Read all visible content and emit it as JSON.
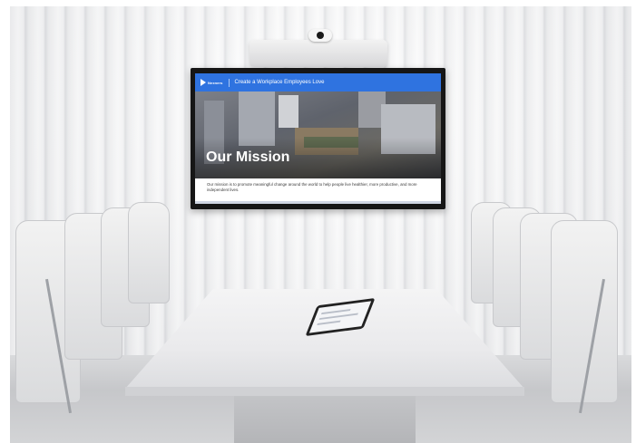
{
  "screen": {
    "logo_text": "Nexners",
    "header_title": "Create a Workplace Employees Love",
    "hero_title": "Our Mission",
    "mission_text": "Our mission is to promote meaningful change around the world to help people live healthier, more productive, and more independent lives."
  },
  "colors": {
    "header_blue": "#2f73e0",
    "tv_frame": "#161616",
    "wall": "#f3f3f4"
  },
  "icons": {
    "logo": "chevron-logo-icon"
  }
}
